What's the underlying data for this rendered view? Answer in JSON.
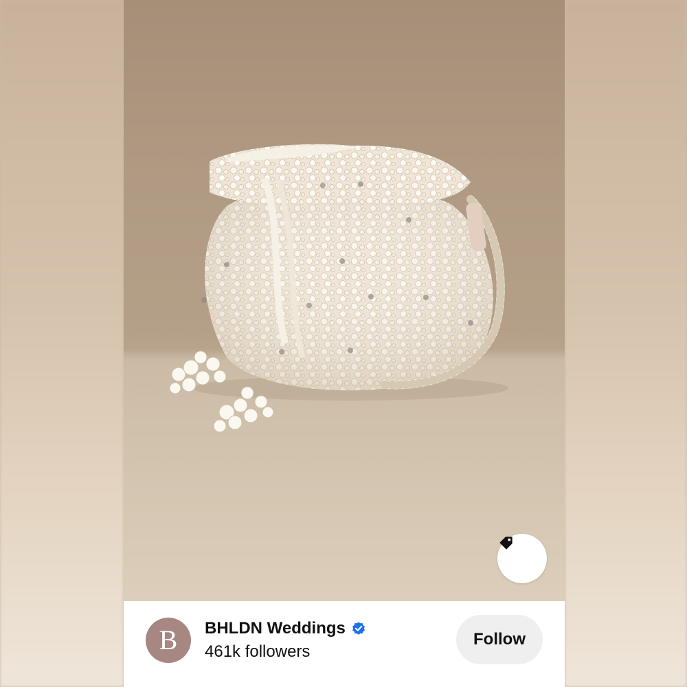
{
  "pin": {
    "image_alt": "Pearl-beaded ivory drawstring pouch bag with tassels",
    "tag_icon": "tag-icon"
  },
  "creator": {
    "avatar_letter": "B",
    "name": "BHLDN Weddings",
    "verified_icon": "verified-badge-icon",
    "followers": "461k followers",
    "follow_label": "Follow"
  },
  "colors": {
    "verified_blue": "#1d6ff2",
    "avatar_bg": "#a78782",
    "follow_bg": "#efefef"
  }
}
